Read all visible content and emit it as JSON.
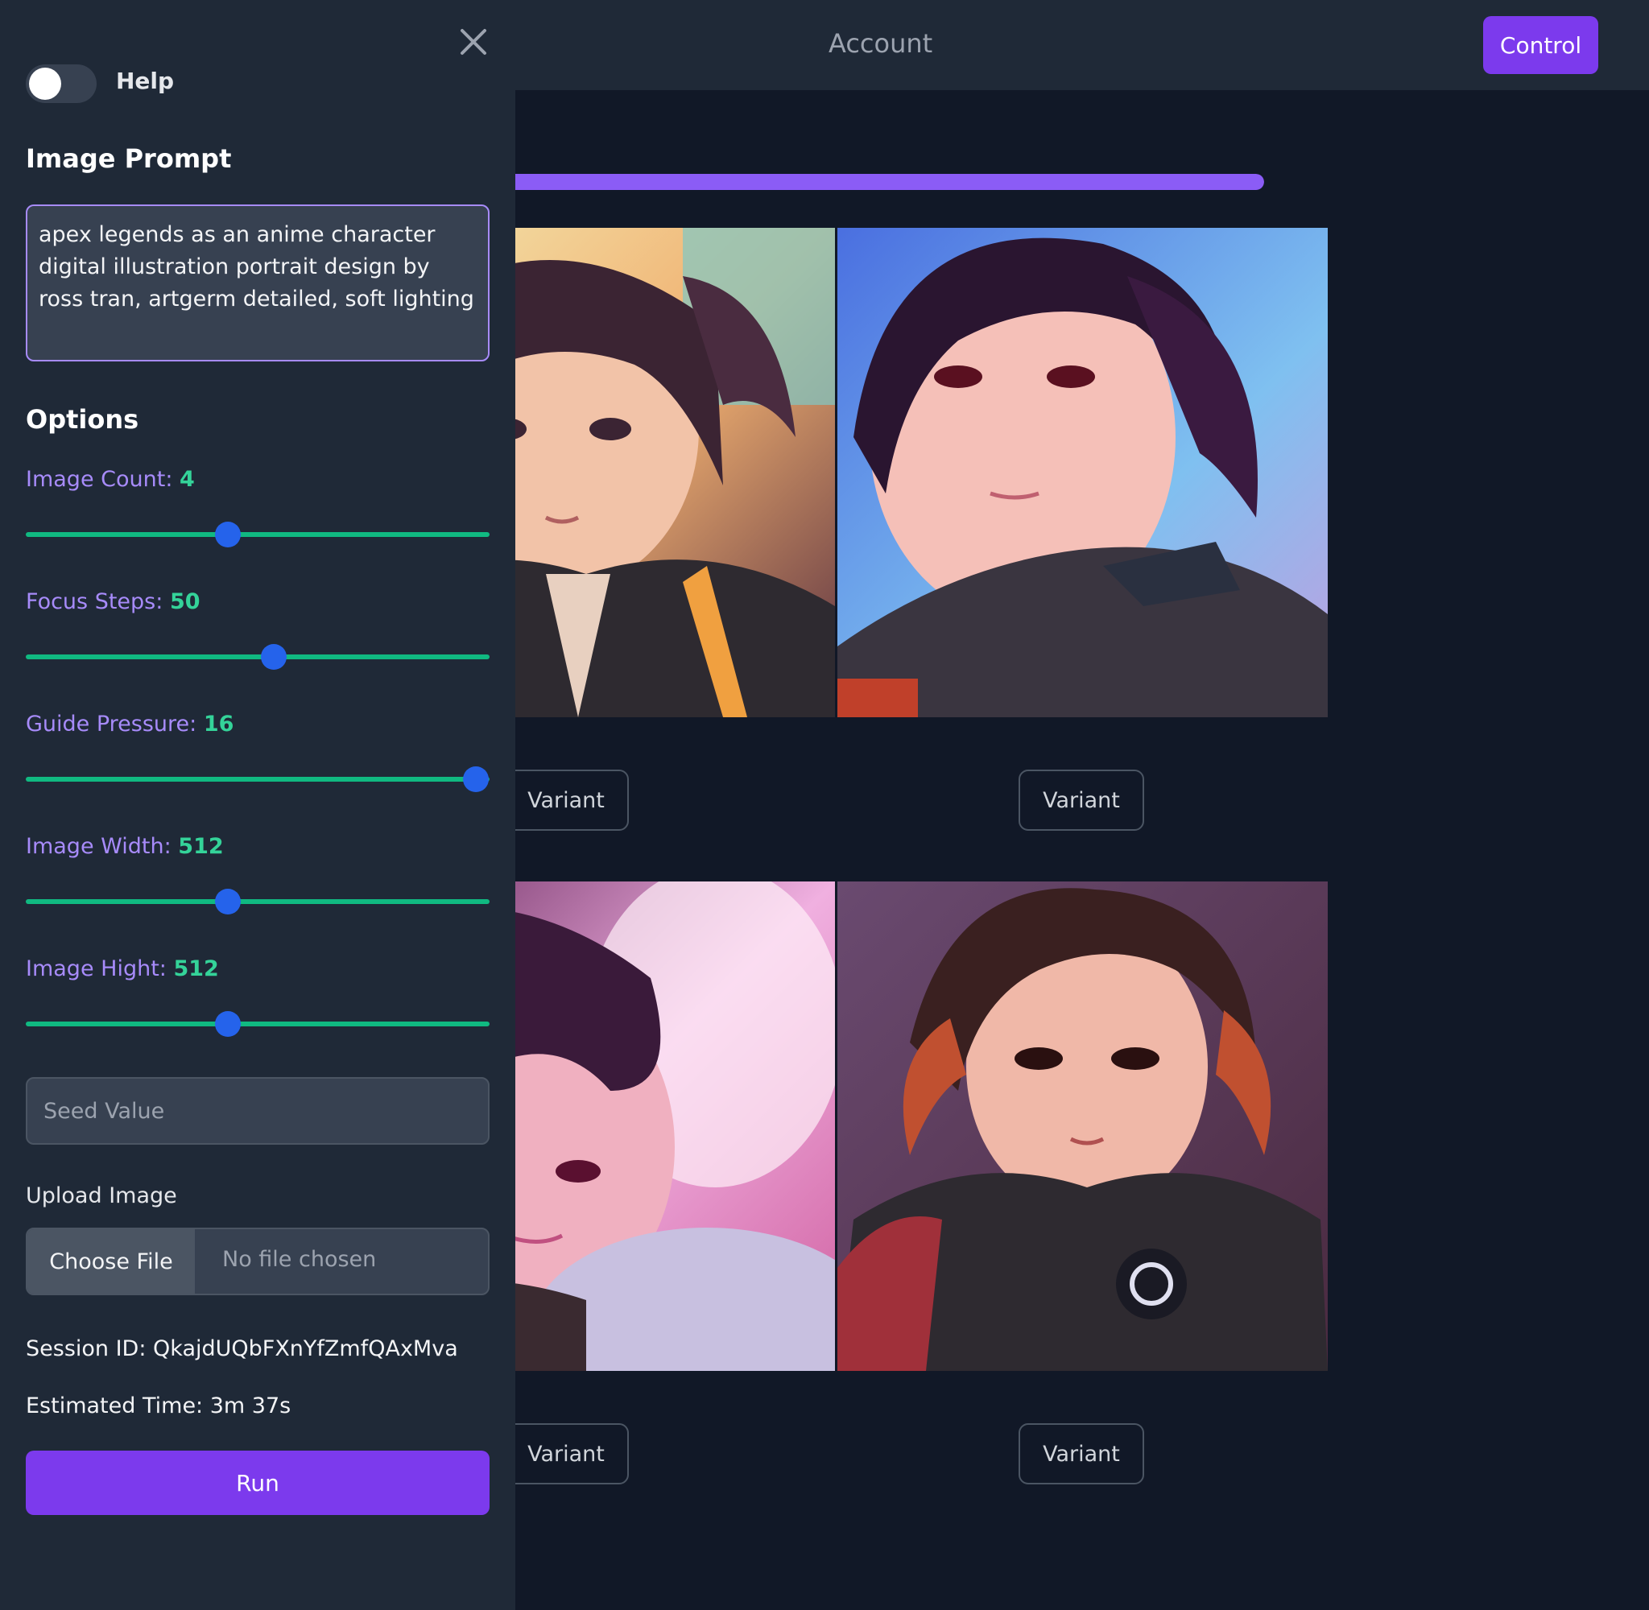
{
  "header": {
    "title": "Account",
    "control_label": "Control"
  },
  "sidebar": {
    "help_label": "Help",
    "help_toggle_on": false,
    "prompt_title": "Image Prompt",
    "prompt_value": "apex legends as an anime character digital illustration portrait design by ross tran, artgerm detailed, soft lighting",
    "options_title": "Options",
    "options": [
      {
        "label": "Image Count:",
        "value": "4",
        "level": 0.435
      },
      {
        "label": "Focus Steps:",
        "value": "50",
        "level": 0.535
      },
      {
        "label": "Guide Pressure:",
        "value": "16",
        "level": 0.97
      },
      {
        "label": "Image Width:",
        "value": "512",
        "level": 0.435
      },
      {
        "label": "Image Hight:",
        "value": "512",
        "level": 0.435
      }
    ],
    "seed_placeholder": "Seed Value",
    "upload_label": "Upload Image",
    "choose_file_label": "Choose File",
    "no_file_label": "No file chosen",
    "session_id": "Session ID: QkajdUQbFXnYfZmfQAxMva",
    "estimated_time": "Estimated Time: 3m 37s",
    "run_label": "Run"
  },
  "main": {
    "progress": 1.0,
    "variant_label": "Variant",
    "images": [
      {
        "name": "generated-image-1"
      },
      {
        "name": "generated-image-2"
      },
      {
        "name": "generated-image-3"
      },
      {
        "name": "generated-image-4"
      }
    ]
  },
  "colors": {
    "accent": "#7c3aed",
    "progress": "#8b5cf6",
    "slider_track": "#10b981",
    "slider_thumb": "#2563eb",
    "label": "#a78bfa",
    "value": "#34d399"
  }
}
